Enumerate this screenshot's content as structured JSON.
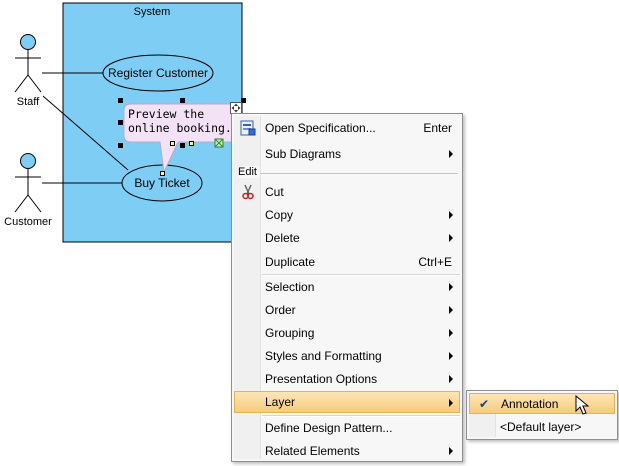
{
  "diagram": {
    "system_title": "System",
    "actors": [
      {
        "name": "Staff"
      },
      {
        "name": "Customer"
      }
    ],
    "use_cases": [
      {
        "name": "Register Customer"
      },
      {
        "name": "Buy Ticket"
      }
    ],
    "annotation": {
      "line1": "Preview the",
      "line2": "online booking."
    },
    "colors": {
      "system_fill": "#7ecdf4",
      "actor_head": "#7ecdf4",
      "callout_fill": "#f3e2f5"
    }
  },
  "context_menu": {
    "open_specification": {
      "label": "Open Specification...",
      "shortcut": "Enter",
      "icon": "specification-icon"
    },
    "sub_diagrams": {
      "label": "Sub Diagrams"
    },
    "edit_header": "Edit",
    "cut": {
      "label": "Cut",
      "icon": "scissors-icon"
    },
    "copy": {
      "label": "Copy"
    },
    "delete": {
      "label": "Delete"
    },
    "duplicate": {
      "label": "Duplicate",
      "shortcut": "Ctrl+E"
    },
    "selection": {
      "label": "Selection"
    },
    "order": {
      "label": "Order"
    },
    "grouping": {
      "label": "Grouping"
    },
    "styles_formatting": {
      "label": "Styles and Formatting"
    },
    "presentation_options": {
      "label": "Presentation Options"
    },
    "layer": {
      "label": "Layer"
    },
    "define_design_pattern": {
      "label": "Define Design Pattern..."
    },
    "related_elements": {
      "label": "Related Elements"
    }
  },
  "layer_submenu": {
    "annotation": {
      "label": "Annotation",
      "checked": true
    },
    "default_layer": {
      "label": "<Default layer>"
    }
  }
}
